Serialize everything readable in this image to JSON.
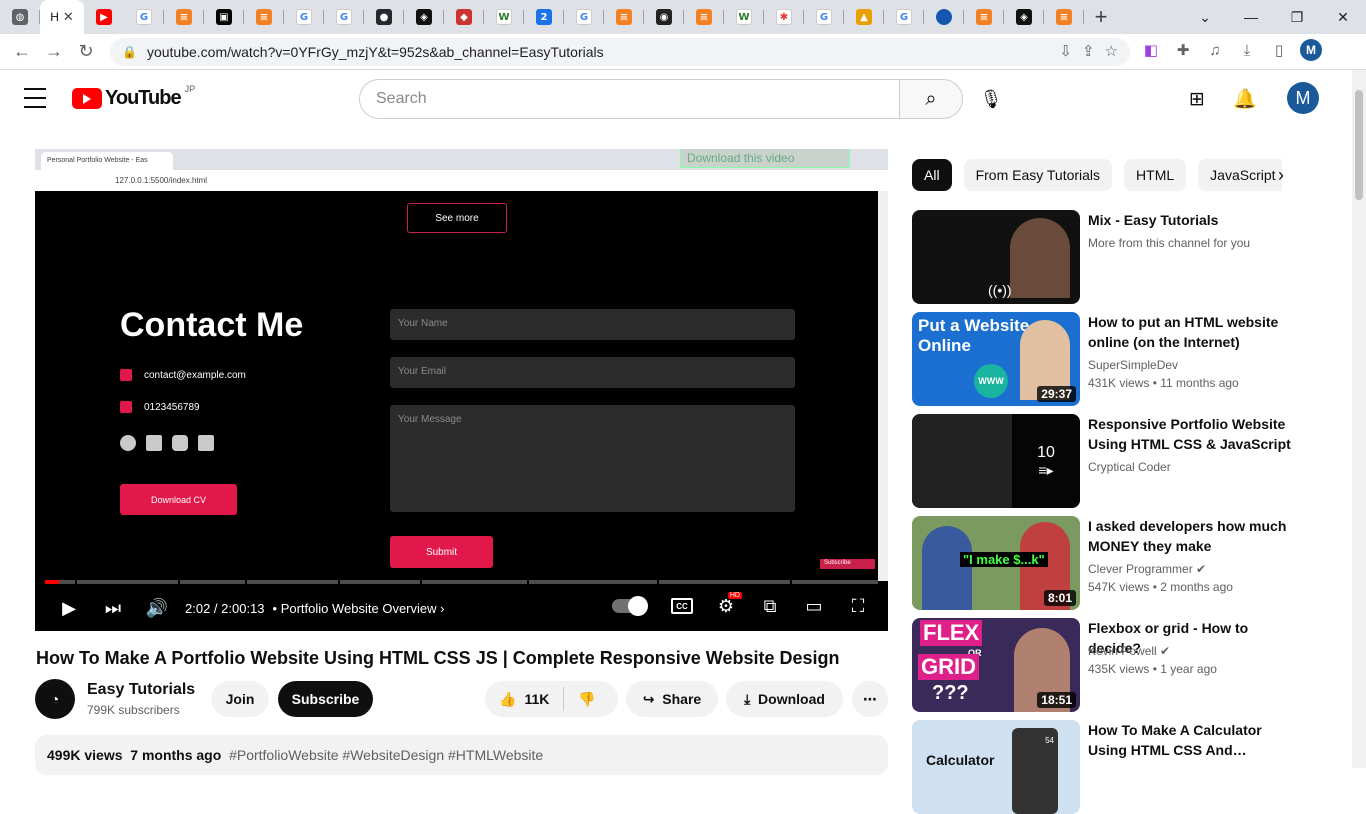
{
  "browser": {
    "active_tab_label": "H",
    "url": "youtube.com/watch?v=0YFrGy_mzjY&t=952s&ab_channel=EasyTutorials",
    "profile_initial": "M"
  },
  "header": {
    "logo_text": "YouTube",
    "region": "JP",
    "search_placeholder": "Search",
    "avatar_initial": "M"
  },
  "player": {
    "inner_tab_title": "Personal Portfolio Website - Eas",
    "inner_url": "127.0.0.1:5500/index.html",
    "download_overlay": "Download this video",
    "see_more": "See more",
    "contact_title": "Contact Me",
    "email": "contact@example.com",
    "phone": "0123456789",
    "download_cv": "Download CV",
    "name_placeholder": "Your Name",
    "email_placeholder": "Your Email",
    "message_placeholder": "Your Message",
    "submit": "Submit",
    "subscribe_chip": "Subscribe",
    "time": "2:02 / 2:00:13",
    "chapter": "Portfolio Website Overview",
    "progress_fraction": 0.017,
    "hd_badge": "HD"
  },
  "video": {
    "title": "How To Make A Portfolio Website Using HTML CSS JS | Complete Responsive Website Design",
    "channel": "Easy Tutorials",
    "subscribers": "799K subscribers",
    "join": "Join",
    "subscribe": "Subscribe",
    "likes": "11K",
    "share": "Share",
    "download": "Download",
    "views": "499K views",
    "date": "7 months ago",
    "tags": "#PortfolioWebsite #WebsiteDesign #HTMLWebsite"
  },
  "sidebar": {
    "chips": [
      "All",
      "From Easy Tutorials",
      "HTML",
      "JavaScript"
    ],
    "recommendations": [
      {
        "title": "Mix - Easy Tutorials",
        "channel": "More from this channel for you",
        "meta": "",
        "duration": ""
      },
      {
        "title": "How to put an HTML website online (on the Internet)",
        "channel": "SuperSimpleDev",
        "meta": "431K views • 11 months ago",
        "duration": "29:37"
      },
      {
        "title": "Responsive Portfolio Website Using HTML CSS & JavaScript",
        "channel": "Cryptical Coder",
        "meta": "",
        "duration": ""
      },
      {
        "title": "I asked developers how much MONEY they make",
        "channel": "Clever Programmer",
        "meta": "547K views • 2 months ago",
        "duration": "8:01"
      },
      {
        "title": "Flexbox or grid - How to decide?",
        "channel": "Kevin Powell",
        "meta": "435K views • 1 year ago",
        "duration": "18:51"
      },
      {
        "title": "How To Make A Calculator Using HTML CSS And…",
        "channel": "",
        "meta": "",
        "duration": ""
      }
    ],
    "thumb_texts": {
      "t2_line1": "Put a Website",
      "t2_line2": "Online",
      "t2_badge": "WWW",
      "t3_count": "10",
      "t4_caption": "\"I make $...k\"",
      "t5_flex": "FLEX",
      "t5_or": "OR",
      "t5_grid": "GRID",
      "t5_q": "???",
      "t6_text": "Calculator",
      "t6_num": "54"
    }
  }
}
